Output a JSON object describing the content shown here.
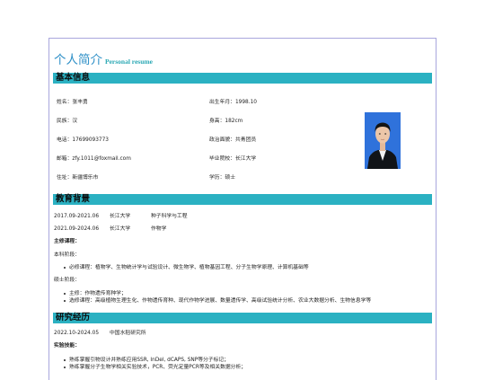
{
  "header": {
    "title": "个人简介",
    "subtitle": "Personal resume"
  },
  "sections": {
    "basic": "基本信息",
    "education": "教育背景",
    "research": "研究经历"
  },
  "basic_info": {
    "left": [
      "姓名：张丰勇",
      "民族：汉",
      "电话：17699093773",
      "邮箱：zfy.1011@foxmail.com",
      "住址：新疆博乐市"
    ],
    "right": [
      "出生年月：1998.10",
      "身高：182cm",
      "政治面貌：共青团员",
      "毕业院校：长江大学",
      "学历：硕士"
    ]
  },
  "education": {
    "rows": [
      {
        "period": "2017.09-2021.06",
        "school": "长江大学",
        "major": "种子科学与工程"
      },
      {
        "period": "2021.09-2024.06",
        "school": "长江大学",
        "major": "作物学"
      }
    ],
    "courses_title": "主修课程：",
    "undergrad_label": "本科阶段：",
    "undergrad_items": [
      "必修课程：植物学、生物统计学与试验设计、微生物学、植物基因工程、分子生物学原理、计算机基础等"
    ],
    "master_label": "硕士阶段：",
    "master_items": [
      "主修：作物遗传育种学；",
      "选修课程：高级植物生理生化、作物遗传育种、现代作物学进展、数量遗传学、高级试验统计分析、农业大数据分析、生物信息学等"
    ]
  },
  "research": {
    "period": "2022.10-2024.05",
    "place": "中国水稻研究所",
    "skills_title": "实验技能：",
    "items": [
      "熟练掌握引物设计并熟练应用SSR, InDel, dCAPS, SNP等分子标记；",
      "熟练掌握分子生物学相关实验技术，PCR、荧光定量PCR等及相关数据分析；"
    ]
  },
  "colors": {
    "accent_bar": "#2bb1c2",
    "title": "#2d8fc7",
    "border": "#a9a6dd",
    "photo_bg": "#2e6fd6"
  },
  "photo": {
    "icon": "portrait-photo"
  }
}
